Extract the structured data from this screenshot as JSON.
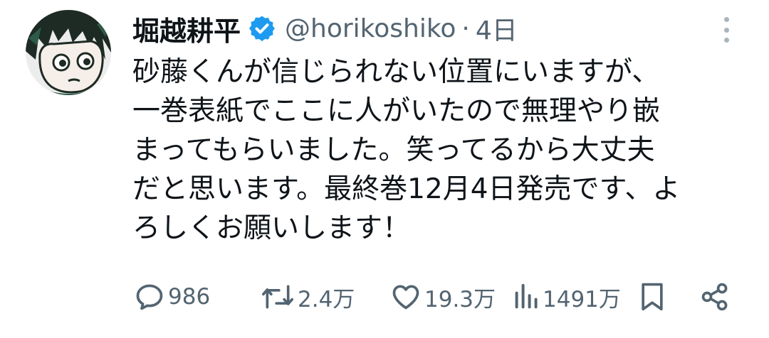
{
  "author": {
    "display_name": "堀越耕平",
    "handle": "@horikoshiko",
    "separator": "·",
    "time": "4日",
    "verified": true,
    "avatar_icon": "avatar-illustration"
  },
  "text_lines": [
    "砂藤くんが信じられない位置にいますが、",
    "一巻表紙でここに人がいたので無理やり嵌",
    "まってもらいました。笑ってるから大丈夫",
    "だと思います。最終巻12月4日発売です、よ",
    "ろしくお願いします！"
  ],
  "actions": {
    "reply": {
      "icon": "reply-icon",
      "count": "986"
    },
    "retweet": {
      "icon": "retweet-icon",
      "count": "2.4万"
    },
    "like": {
      "icon": "heart-icon",
      "count": "19.3万"
    },
    "views": {
      "icon": "views-icon",
      "count": "1491万"
    },
    "bookmark": {
      "icon": "bookmark-icon"
    },
    "share": {
      "icon": "share-icon"
    }
  },
  "colors": {
    "text": "#0f1419",
    "secondary": "#536471",
    "verified": "#1d9bf0",
    "background": "#ffffff"
  }
}
